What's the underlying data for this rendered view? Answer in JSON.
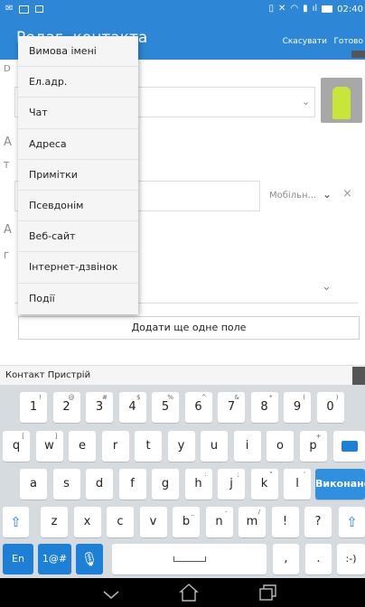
{
  "status": {
    "time": "02:40"
  },
  "appbar": {
    "title": "Редаг. контакта",
    "cancel": "Скасувати",
    "done": "Готово"
  },
  "popup": {
    "items": [
      "Вимова імені",
      "Ел.адр.",
      "Чат",
      "Адреса",
      "Примітки",
      "Псевдонім",
      "Веб-сайт",
      "Інтернет-дзвінок",
      "Події"
    ]
  },
  "form": {
    "mobile_label": "Мобільн...",
    "add_field": "Додати ще одне поле"
  },
  "section": {
    "label": "Контакт Пристрій"
  },
  "keyboard": {
    "row1": [
      {
        "k": "1",
        "s": "!"
      },
      {
        "k": "2",
        "s": "@"
      },
      {
        "k": "3",
        "s": "#"
      },
      {
        "k": "4",
        "s": "$"
      },
      {
        "k": "5",
        "s": "%"
      },
      {
        "k": "6",
        "s": "^"
      },
      {
        "k": "7",
        "s": "&"
      },
      {
        "k": "8",
        "s": "*"
      },
      {
        "k": "9",
        "s": "("
      },
      {
        "k": "0",
        "s": ")"
      }
    ],
    "row2": [
      {
        "k": "q",
        "s": "["
      },
      {
        "k": "w",
        "s": "]"
      },
      {
        "k": "e",
        "s": ""
      },
      {
        "k": "r",
        "s": ""
      },
      {
        "k": "t",
        "s": ""
      },
      {
        "k": "y",
        "s": ""
      },
      {
        "k": "u",
        "s": ""
      },
      {
        "k": "i",
        "s": ""
      },
      {
        "k": "o",
        "s": ""
      },
      {
        "k": "p",
        "s": "+"
      }
    ],
    "row3": [
      {
        "k": "a",
        "s": ""
      },
      {
        "k": "s",
        "s": ""
      },
      {
        "k": "d",
        "s": ""
      },
      {
        "k": "f",
        "s": ""
      },
      {
        "k": "g",
        "s": ""
      },
      {
        "k": "h",
        "s": ":"
      },
      {
        "k": "j",
        "s": ";"
      },
      {
        "k": "k",
        "s": "\""
      },
      {
        "k": "l",
        "s": "'"
      }
    ],
    "done_key": "Виконано",
    "row4": [
      {
        "k": "z",
        "s": ""
      },
      {
        "k": "x",
        "s": ""
      },
      {
        "k": "c",
        "s": ""
      },
      {
        "k": "v",
        "s": ""
      },
      {
        "k": "b",
        "s": "_"
      },
      {
        "k": "n",
        "s": "-"
      },
      {
        "k": "m",
        "s": "/"
      },
      {
        "k": "!",
        "s": ""
      },
      {
        "k": "?",
        "s": ""
      }
    ],
    "lang_key": "En",
    "sym_key": "1@#",
    "comma": ",",
    "period": ".",
    "smiley": ":-)"
  },
  "colors": {
    "accent": "#2d87d6",
    "keyboard_bg": "#d6dbe0"
  }
}
